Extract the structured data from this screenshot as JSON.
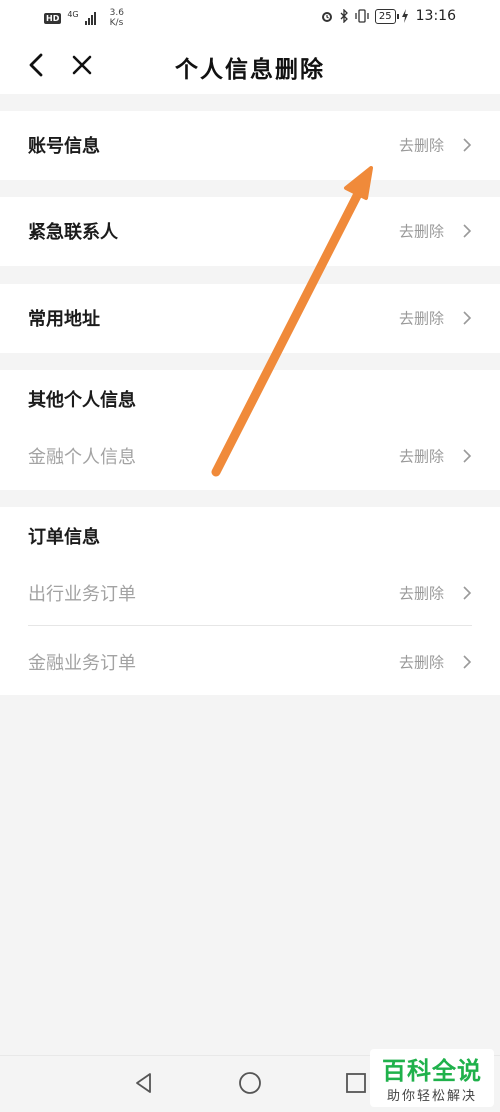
{
  "status_bar": {
    "hd_badge": "HD",
    "signal_label": "4G",
    "net_speed_value": "3.6",
    "net_speed_unit": "K/s",
    "battery_level": "25",
    "time": "13:16"
  },
  "header": {
    "title": "个人信息删除"
  },
  "sections": {
    "account": {
      "label": "账号信息",
      "action": "去删除"
    },
    "emergency": {
      "label": "紧急联系人",
      "action": "去删除"
    },
    "address": {
      "label": "常用地址",
      "action": "去删除"
    },
    "other": {
      "title": "其他个人信息",
      "items": [
        {
          "label": "金融个人信息",
          "action": "去删除"
        }
      ]
    },
    "orders": {
      "title": "订单信息",
      "items": [
        {
          "label": "出行业务订单",
          "action": "去删除"
        },
        {
          "label": "金融业务订单",
          "action": "去删除"
        }
      ]
    }
  },
  "annotation": {
    "color": "#f08a3a"
  },
  "watermark": {
    "title": "百科全说",
    "subtitle": "助你轻松解决"
  },
  "icons": {
    "back": "chevron-left-icon",
    "close": "close-icon",
    "row_chevron": "chevron-right-icon",
    "system_back": "triangle-back-icon",
    "system_home": "circle-home-icon",
    "system_recent": "square-recent-icon"
  }
}
